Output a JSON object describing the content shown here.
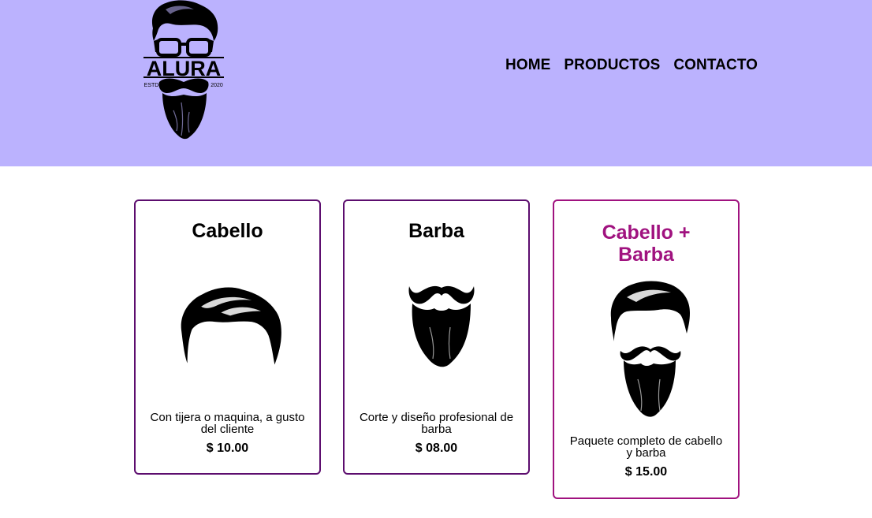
{
  "header": {
    "logo": {
      "text": "ALURA",
      "left_caption": "ESTD",
      "right_caption": "2020"
    },
    "nav": [
      {
        "label": "HOME"
      },
      {
        "label": "PRODUCTOS"
      },
      {
        "label": "CONTACTO"
      }
    ]
  },
  "products": [
    {
      "title": "Cabello",
      "description": "Con tijera o maquina, a gusto del cliente",
      "price": "$ 10.00",
      "icon": "hair-icon"
    },
    {
      "title": "Barba",
      "description": "Corte y diseño profesional de barba",
      "price": "$ 08.00",
      "icon": "beard-icon"
    },
    {
      "title": "Cabello + Barba",
      "description": "Paquete completo de cabello y barba",
      "price": "$ 15.00",
      "icon": "hair-beard-icon"
    }
  ],
  "colors": {
    "header_bg": "#bbb2fe",
    "card_border": "#5c0d6e",
    "highlight": "#a0127f"
  }
}
